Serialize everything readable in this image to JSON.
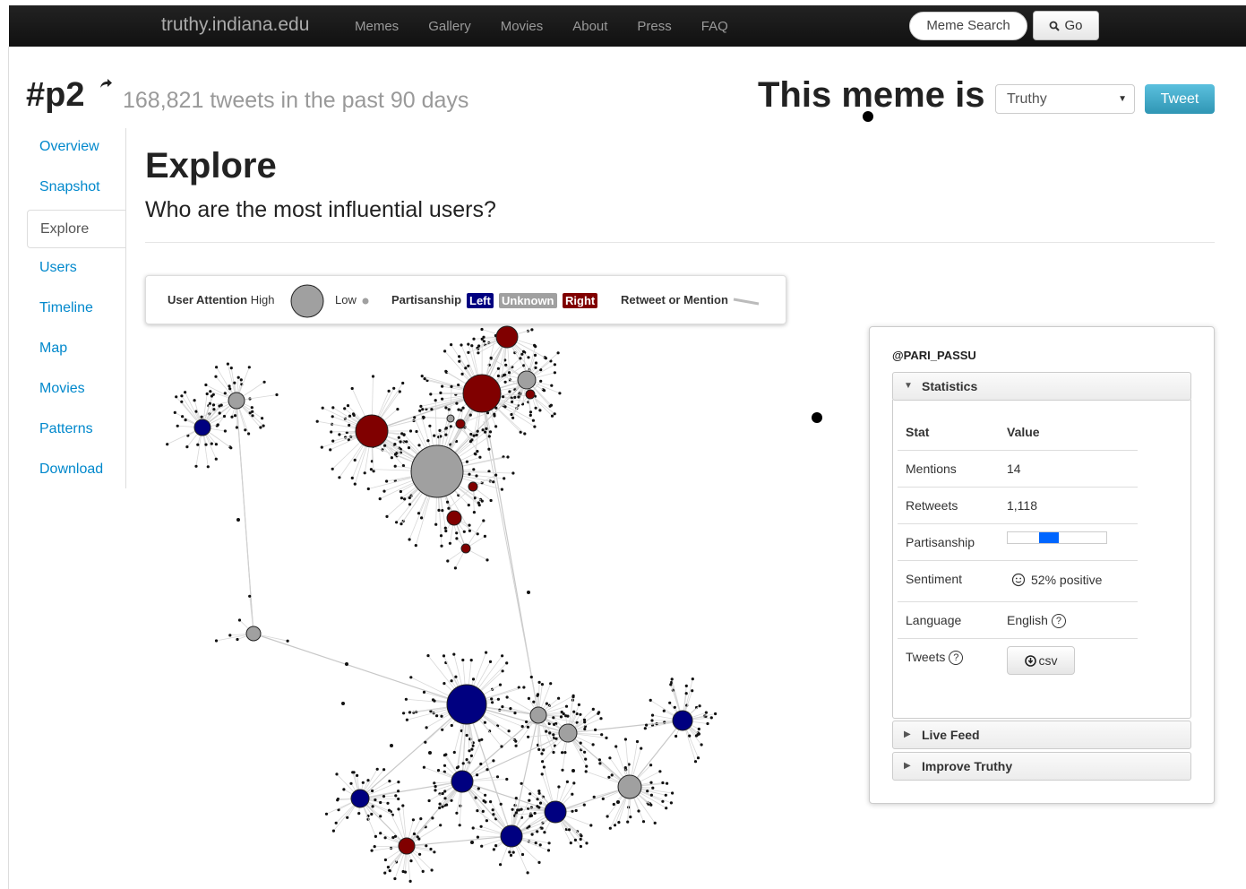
{
  "navbar": {
    "brand": "truthy.indiana.edu",
    "links": [
      "Memes",
      "Gallery",
      "Movies",
      "About",
      "Press",
      "FAQ"
    ],
    "search_label": "Meme Search",
    "go_label": "Go"
  },
  "header": {
    "meme_name": "#p2",
    "tweet_count": "168,821 tweets in the past 90 days",
    "meme_is_label": "This meme is",
    "classification_selected": "Truthy",
    "tweet_button": "Tweet"
  },
  "sidebar": {
    "items": [
      {
        "label": "Overview",
        "active": false
      },
      {
        "label": "Snapshot",
        "active": false
      },
      {
        "label": "Explore",
        "active": true
      },
      {
        "label": "Users",
        "active": false
      },
      {
        "label": "Timeline",
        "active": false
      },
      {
        "label": "Map",
        "active": false
      },
      {
        "label": "Movies",
        "active": false
      },
      {
        "label": "Patterns",
        "active": false
      },
      {
        "label": "Download",
        "active": false
      }
    ]
  },
  "main": {
    "title": "Explore",
    "subtitle": "Who are the most influential users?"
  },
  "legend": {
    "attention_label": "User Attention",
    "high": "High",
    "low": "Low",
    "partisanship_label": "Partisanship",
    "left": "Left",
    "unknown": "Unknown",
    "right": "Right",
    "edge_label": "Retweet or Mention",
    "colors": {
      "left": "#000080",
      "unknown": "#a0a0a0",
      "right": "#800000"
    }
  },
  "user_panel": {
    "username": "@PARI_PASSU",
    "statistics_label": "Statistics",
    "stat_header": "Stat",
    "value_header": "Value",
    "mentions_label": "Mentions",
    "mentions": "14",
    "retweets_label": "Retweets",
    "retweets": "1,118",
    "partisanship_label": "Partisanship",
    "partisanship_fraction": 0.4,
    "sentiment_label": "Sentiment",
    "sentiment": "52% positive",
    "language_label": "Language",
    "language": "English",
    "tweets_label": "Tweets",
    "csv_label": "csv",
    "live_feed_label": "Live Feed",
    "improve_label": "Improve Truthy"
  }
}
